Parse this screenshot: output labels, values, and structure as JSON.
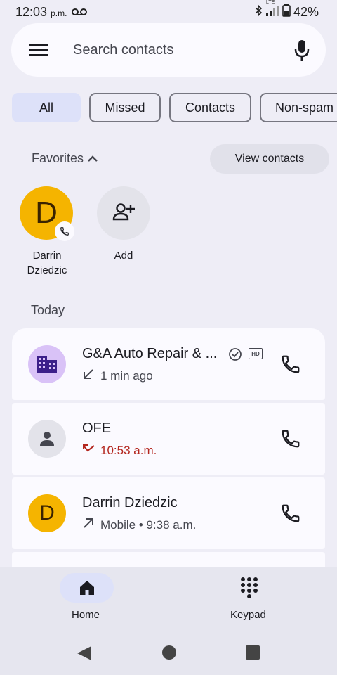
{
  "status": {
    "time": "12:03",
    "ampm": "p.m.",
    "network": "LTE",
    "battery": "42%"
  },
  "search": {
    "placeholder": "Search contacts"
  },
  "filters": [
    "All",
    "Missed",
    "Contacts",
    "Non-spam"
  ],
  "favorites": {
    "header": "Favorites",
    "view_contacts": "View contacts",
    "items": [
      {
        "initial": "D",
        "name_line1": "Darrin",
        "name_line2": "Dziedzic"
      },
      {
        "name": "Add"
      }
    ]
  },
  "section_today": "Today",
  "calls": [
    {
      "name": "G&A Auto Repair & ...",
      "detail": "1 min ago",
      "direction": "incoming",
      "badge": "HD"
    },
    {
      "name": "OFE",
      "detail": "10:53 a.m.",
      "direction": "missed"
    },
    {
      "initial": "D",
      "name": "Darrin Dziedzic",
      "detail": "Mobile • 9:38 a.m.",
      "direction": "outgoing"
    }
  ],
  "nav": {
    "home": "Home",
    "keypad": "Keypad"
  },
  "colors": {
    "background": "#eeedf6",
    "accent_chip": "#dde1f9",
    "avatar_yellow": "#f5b400",
    "avatar_purple": "#d9c2f7",
    "missed_red": "#b3261e"
  }
}
